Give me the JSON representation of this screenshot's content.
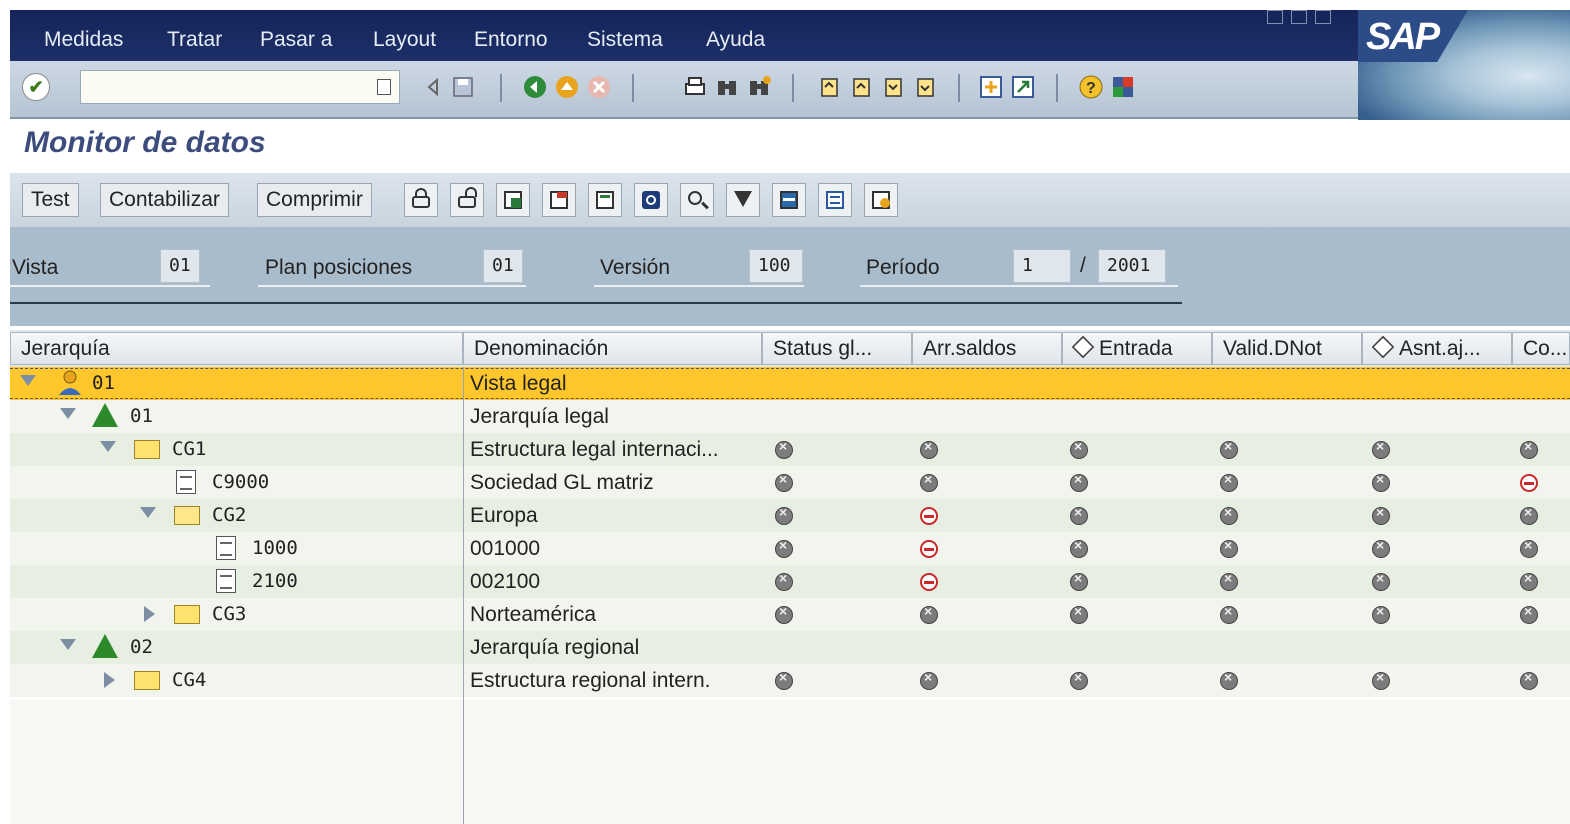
{
  "menu": {
    "items": [
      "Medidas",
      "Tratar",
      "Pasar a",
      "Layout",
      "Entorno",
      "Sistema",
      "Ayuda"
    ]
  },
  "logo": "SAP",
  "toolbar": {
    "command_field_value": ""
  },
  "title": "Monitor de datos",
  "app_toolbar": {
    "buttons": [
      "Test",
      "Contabilizar",
      "Comprimir"
    ]
  },
  "header": {
    "vista_label": "Vista",
    "vista_value": "01",
    "plan_label": "Plan posiciones",
    "plan_value": "01",
    "version_label": "Versión",
    "version_value": "100",
    "periodo_label": "Período",
    "periodo_value": "1",
    "periodo_sep": "/",
    "year_value": "2001"
  },
  "table": {
    "columns": [
      "Jerarquía",
      "Denominación",
      "Status gl...",
      "Arr.saldos",
      "Entrada",
      "Valid.DNot",
      "Asnt.aj...",
      "Co..."
    ],
    "rows": [
      {
        "code": "01",
        "name": "Vista legal",
        "status": [
          "",
          "",
          "",
          "",
          "",
          ""
        ]
      },
      {
        "code": "01",
        "name": "Jerarquía legal",
        "status": [
          "",
          "",
          "",
          "",
          "",
          ""
        ]
      },
      {
        "code": "CG1",
        "name": "Estructura legal internaci...",
        "status": [
          "gray",
          "gray",
          "gray",
          "gray",
          "gray",
          "gray"
        ]
      },
      {
        "code": "C9000",
        "name": "Sociedad GL matriz",
        "status": [
          "gray",
          "gray",
          "gray",
          "gray",
          "gray",
          "red"
        ]
      },
      {
        "code": "CG2",
        "name": "Europa",
        "status": [
          "gray",
          "red",
          "gray",
          "gray",
          "gray",
          "gray"
        ]
      },
      {
        "code": "1000",
        "name": "001000",
        "status": [
          "gray",
          "red",
          "gray",
          "gray",
          "gray",
          "gray"
        ]
      },
      {
        "code": "2100",
        "name": "002100",
        "status": [
          "gray",
          "red",
          "gray",
          "gray",
          "gray",
          "gray"
        ]
      },
      {
        "code": "CG3",
        "name": "Norteamérica",
        "status": [
          "gray",
          "gray",
          "gray",
          "gray",
          "gray",
          "gray"
        ]
      },
      {
        "code": "02",
        "name": "Jerarquía regional",
        "status": [
          "",
          "",
          "",
          "",
          "",
          ""
        ]
      },
      {
        "code": "CG4",
        "name": "Estructura regional intern.",
        "status": [
          "gray",
          "gray",
          "gray",
          "gray",
          "gray",
          "gray"
        ]
      }
    ]
  },
  "colors": {
    "menubar": "#1a2a5c",
    "selected_row": "#ffc72c",
    "header_bg": "#a9bccc",
    "title": "#3c4c7c"
  }
}
